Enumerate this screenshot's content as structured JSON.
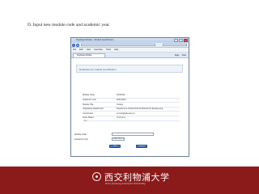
{
  "slide": {
    "caption": "D. Input new module code and academic year."
  },
  "browser": {
    "title_text": "Duplicate Module - Module Specification",
    "menu": [
      "File",
      "Edit",
      "View",
      "Favorites",
      "Tools",
      "Help"
    ],
    "tab_label": "Duplicate Module",
    "tab_tools": [
      "Page",
      "Tools"
    ]
  },
  "page": {
    "pane_title": "Duplicate the module specification",
    "details": [
      {
        "label": "Module Code",
        "value": "TEST001"
      },
      {
        "label": "Academic Year",
        "value": "2010-2011"
      },
      {
        "label": "Module Title",
        "value": "Testing"
      },
      {
        "label": "Originating Department",
        "value": "Department of Electrical and Electronic Engineering"
      },
      {
        "label": "Coordinator",
        "value": "xu.test@xjtlu.edu.cn"
      },
      {
        "label": "Team Status",
        "value": "Published"
      }
    ],
    "form_heading": "To:",
    "form": {
      "module_code_label": "Module Code",
      "academic_year_label": "Academic Year",
      "academic_year_value": "2009-2010"
    },
    "buttons": {
      "ok": "OK",
      "cancel": "Cancel"
    }
  },
  "banner": {
    "name": "西交利物浦大学",
    "sub": "Xi'an Jiaotong-Liverpool University"
  },
  "icons": [
    "back-arrow-icon",
    "forward-arrow-icon",
    "university-emblem-icon",
    "select-arrow-icon"
  ],
  "colors": {
    "banner": "#8b1a1a",
    "status_published": "#2e7d32",
    "button": "#2f62a8"
  }
}
